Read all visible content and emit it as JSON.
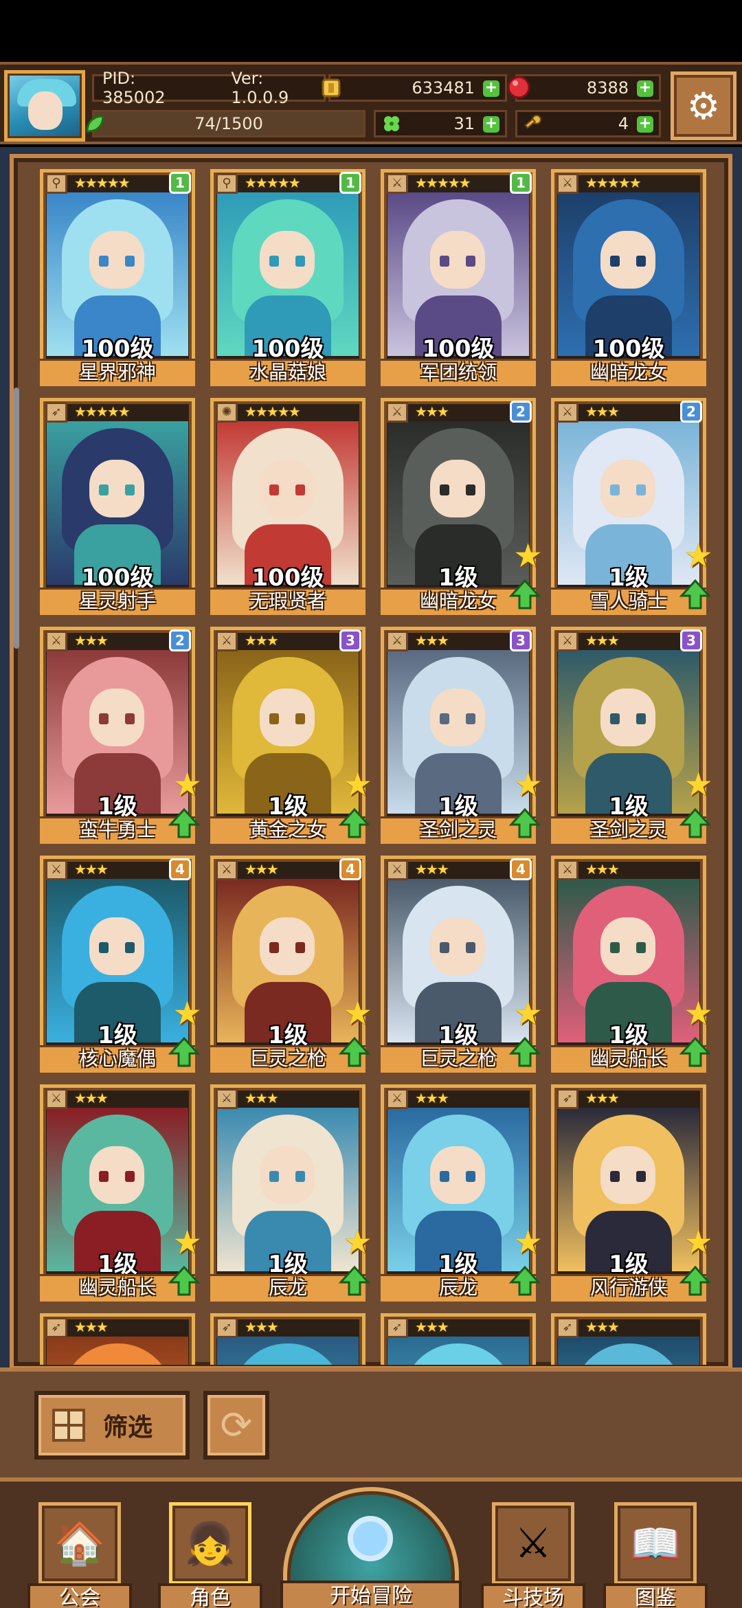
{
  "hud": {
    "pid_label": "PID: 385002",
    "version_label": "Ver: 1.0.0.9",
    "gold": "633481",
    "gems": "8388",
    "exp": "74/1500",
    "clover": "31",
    "keys": "4"
  },
  "colors": {
    "accent_gold": "#e6ae52",
    "plus_green": "#54c23e",
    "badge_green": "#54b848",
    "badge_blue": "#4a8fd6",
    "badge_purple": "#8a52c8",
    "badge_orange": "#d88a2e"
  },
  "cards": [
    {
      "name": "星界邪神",
      "level": "100级",
      "stars": "★★★★★",
      "rank": "1",
      "rank_color": "#54b848",
      "type_icon": "staff-icon",
      "upgrade": false,
      "palette": [
        "#9fe0f0",
        "#3a86c8"
      ]
    },
    {
      "name": "水晶菇娘",
      "level": "100级",
      "stars": "★★★★★",
      "rank": "1",
      "rank_color": "#54b848",
      "type_icon": "staff-icon",
      "upgrade": false,
      "palette": [
        "#5fd8c0",
        "#2f9bb8"
      ]
    },
    {
      "name": "军团统领",
      "level": "100级",
      "stars": "★★★★★",
      "rank": "1",
      "rank_color": "#54b848",
      "type_icon": "sword-icon",
      "upgrade": false,
      "palette": [
        "#c9c4de",
        "#5a4a86"
      ]
    },
    {
      "name": "幽暗龙女",
      "level": "100级",
      "stars": "★★★★★",
      "rank": "",
      "rank_color": "",
      "type_icon": "sword-icon",
      "upgrade": false,
      "palette": [
        "#2e6fb0",
        "#1d3f6a"
      ]
    },
    {
      "name": "星灵射手",
      "level": "100级",
      "stars": "★★★★★",
      "rank": "",
      "rank_color": "",
      "type_icon": "bow-icon",
      "upgrade": false,
      "palette": [
        "#2a3a6a",
        "#3aa0a0"
      ]
    },
    {
      "name": "无瑕贤者",
      "level": "100级",
      "stars": "★★★★★",
      "rank": "",
      "rank_color": "",
      "type_icon": "sun-icon",
      "upgrade": false,
      "palette": [
        "#f0e0cc",
        "#c23a34"
      ]
    },
    {
      "name": "幽暗龙女",
      "level": "1级",
      "stars": "★★★",
      "rank": "2",
      "rank_color": "#4a8fd6",
      "type_icon": "sword-icon",
      "upgrade": true,
      "palette": [
        "#5a5e5a",
        "#2a2c2a"
      ]
    },
    {
      "name": "雪人骑士",
      "level": "1级",
      "stars": "★★★",
      "rank": "2",
      "rank_color": "#4a8fd6",
      "type_icon": "sword-icon",
      "upgrade": true,
      "palette": [
        "#dfe8f4",
        "#7ab4d8"
      ]
    },
    {
      "name": "蛮牛勇士",
      "level": "1级",
      "stars": "★★★",
      "rank": "2",
      "rank_color": "#4a8fd6",
      "type_icon": "sword-icon",
      "upgrade": true,
      "palette": [
        "#e89a9a",
        "#8c3a3a"
      ]
    },
    {
      "name": "黄金之女",
      "level": "1级",
      "stars": "★★★",
      "rank": "3",
      "rank_color": "#8a52c8",
      "type_icon": "sword-icon",
      "upgrade": true,
      "palette": [
        "#e0b83a",
        "#8a6418"
      ]
    },
    {
      "name": "圣剑之灵",
      "level": "1级",
      "stars": "★★★",
      "rank": "3",
      "rank_color": "#8a52c8",
      "type_icon": "sword-icon",
      "upgrade": true,
      "palette": [
        "#c8dceb",
        "#5a6a80"
      ]
    },
    {
      "name": "圣剑之灵",
      "level": "1级",
      "stars": "★★★",
      "rank": "3",
      "rank_color": "#8a52c8",
      "type_icon": "sword-icon",
      "upgrade": true,
      "palette": [
        "#b6a24a",
        "#2e5a6a"
      ]
    },
    {
      "name": "核心魔偶",
      "level": "1级",
      "stars": "★★★",
      "rank": "4",
      "rank_color": "#d88a2e",
      "type_icon": "sword-icon",
      "upgrade": true,
      "palette": [
        "#3ab0e0",
        "#1d5a6a"
      ]
    },
    {
      "name": "巨灵之枪",
      "level": "1级",
      "stars": "★★★",
      "rank": "4",
      "rank_color": "#d88a2e",
      "type_icon": "sword-icon",
      "upgrade": true,
      "palette": [
        "#e8b45a",
        "#7a2a20"
      ]
    },
    {
      "name": "巨灵之枪",
      "level": "1级",
      "stars": "★★★",
      "rank": "4",
      "rank_color": "#d88a2e",
      "type_icon": "sword-icon",
      "upgrade": true,
      "palette": [
        "#d8e4f0",
        "#4a5a6a"
      ]
    },
    {
      "name": "幽灵船长",
      "level": "1级",
      "stars": "★★★",
      "rank": "",
      "rank_color": "",
      "type_icon": "sword-icon",
      "upgrade": true,
      "palette": [
        "#e0607a",
        "#2e5a4a"
      ]
    },
    {
      "name": "幽灵船长",
      "level": "1级",
      "stars": "★★★",
      "rank": "",
      "rank_color": "",
      "type_icon": "sword-icon",
      "upgrade": true,
      "palette": [
        "#5ab8a0",
        "#8a1e24"
      ]
    },
    {
      "name": "辰龙",
      "level": "1级",
      "stars": "★★★",
      "rank": "",
      "rank_color": "",
      "type_icon": "sword-icon",
      "upgrade": true,
      "palette": [
        "#efe4d0",
        "#3a8ab0"
      ]
    },
    {
      "name": "辰龙",
      "level": "1级",
      "stars": "★★★",
      "rank": "",
      "rank_color": "",
      "type_icon": "sword-icon",
      "upgrade": true,
      "palette": [
        "#7ad0e8",
        "#2a6aa0"
      ]
    },
    {
      "name": "风行游侠",
      "level": "1级",
      "stars": "★★★",
      "rank": "",
      "rank_color": "",
      "type_icon": "bow-icon",
      "upgrade": true,
      "palette": [
        "#f0c060",
        "#2a2a3a"
      ]
    },
    {
      "name": "",
      "level": "",
      "stars": "★★★",
      "rank": "",
      "rank_color": "",
      "type_icon": "bow-icon",
      "upgrade": false,
      "palette": [
        "#f08a3a",
        "#8a3a1a"
      ]
    },
    {
      "name": "",
      "level": "",
      "stars": "★★★",
      "rank": "",
      "rank_color": "",
      "type_icon": "bow-icon",
      "upgrade": false,
      "palette": [
        "#4ab8d8",
        "#2a5a80"
      ]
    },
    {
      "name": "",
      "level": "",
      "stars": "★★★",
      "rank": "",
      "rank_color": "",
      "type_icon": "bow-icon",
      "upgrade": false,
      "palette": [
        "#6ad0e8",
        "#2a6a90"
      ]
    },
    {
      "name": "",
      "level": "",
      "stars": "★★★",
      "rank": "",
      "rank_color": "",
      "type_icon": "bow-icon",
      "upgrade": false,
      "palette": [
        "#5ab8d8",
        "#1e4a6a"
      ]
    }
  ],
  "filter": {
    "label": "筛选"
  },
  "nav": {
    "guild": "公会",
    "characters": "角色",
    "start": "开始冒险",
    "arena": "斗技场",
    "codex": "图鉴"
  }
}
